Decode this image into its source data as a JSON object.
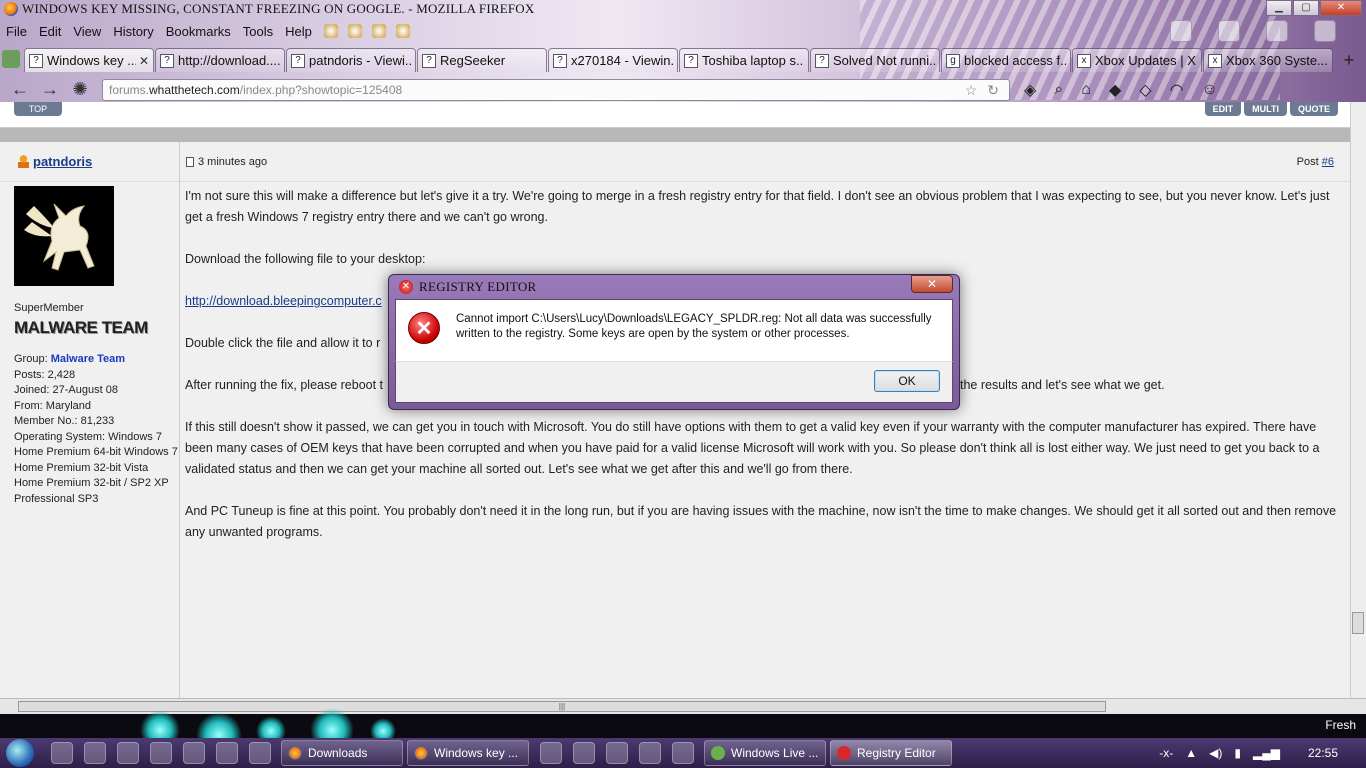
{
  "window": {
    "title": "WINDOWS KEY MISSING, CONSTANT FREEZING ON GOOGLE. - MOZILLA FIREFOX"
  },
  "menu": [
    "File",
    "Edit",
    "View",
    "History",
    "Bookmarks",
    "Tools",
    "Help"
  ],
  "tabs": [
    {
      "label": "Windows key ...",
      "active": true
    },
    {
      "label": "http://download....",
      "active": false
    },
    {
      "label": "patndoris - Viewi...",
      "active": false
    },
    {
      "label": "RegSeeker",
      "active": false
    },
    {
      "label": "x270184 - Viewin...",
      "active": false
    },
    {
      "label": "Toshiba laptop s...",
      "active": false
    },
    {
      "label": "Solved Not runni...",
      "active": false
    },
    {
      "label": "blocked access f...",
      "active": false
    },
    {
      "label": "Xbox Updates | X...",
      "active": false
    },
    {
      "label": "Xbox 360 Syste...",
      "active": false
    }
  ],
  "url": {
    "domain_pre": "forums.",
    "domain": "whatthetech.com",
    "path": "/index.php?showtopic=125408"
  },
  "page": {
    "top_button": "TOP",
    "post_buttons": [
      "EDIT",
      "MULTI",
      "QUOTE"
    ],
    "author": "patndoris",
    "post_time": "3 minutes ago",
    "post_label": "Post ",
    "post_number": "#6",
    "rank": "SuperMember",
    "team_badge": "MALWARE TEAM",
    "stats": {
      "group_label": "Group: ",
      "group": "Malware Team",
      "posts": "Posts: 2,428",
      "joined": "Joined: 27-August 08",
      "from": "From: Maryland",
      "member_no": "Member No.: 81,233",
      "os": "Operating System: Windows 7 Home Premium 64-bit Windows 7 Home Premium 32-bit Vista Home Premium 32-bit / SP2 XP Professional SP3"
    },
    "paragraphs": [
      "I'm not sure this will make a difference but let's give it a try. We're going to merge in a fresh registry entry for that field. I don't see an obvious problem that I was expecting to see, but you never know. Let's just get a fresh Windows 7 registry entry there and we can't go wrong.",
      "Download the following file to your desktop:",
      "",
      "Double click the file and allow it to r",
      "After running the fix, please reboot t",
      "If this still doesn't show it passed, we can get you in touch with Microsoft. You do still have options with them to get a valid key even if your warranty with the computer manufacturer has expired. There have been many cases of OEM keys that have been corrupted and when you have paid for a valid license Microsoft will work with you. So please don't think all is lost either way. We just need to get you back to a validated status and then we can get your machine all sorted out. Let's see what we get after this and we'll go from there.",
      "And PC Tuneup is fine at this point. You probably don't need it in the long run, but if you are having issues with the machine, now isn't the time to make changes. We should get it all sorted out and then remove any unwanted programs."
    ],
    "link": "http://download.bleepingcomputer.c",
    "after_dialog_text": "the results and let's see what we get."
  },
  "dialog": {
    "title": "REGISTRY EDITOR",
    "message": "Cannot import C:\\Users\\Lucy\\Downloads\\LEGACY_SPLDR.reg: Not all data was successfully written to the registry.  Some keys are open by the system or other processes.",
    "ok": "OK",
    "close": "✕"
  },
  "desktop": {
    "user": "Fresh"
  },
  "taskbar": {
    "items": [
      {
        "label": "Downloads",
        "icon": "firefox-icon"
      },
      {
        "label": "Windows key ...",
        "icon": "firefox-icon"
      },
      {
        "label": "Windows Live ...",
        "icon": "messenger-icon"
      },
      {
        "label": "Registry Editor",
        "icon": "error-icon"
      }
    ],
    "tray_text": "-x-",
    "clock": "22:55"
  },
  "colors": {
    "link": "#1a3a8a",
    "group": "#1a3ac0",
    "taskbar": "#3a2c5c"
  }
}
